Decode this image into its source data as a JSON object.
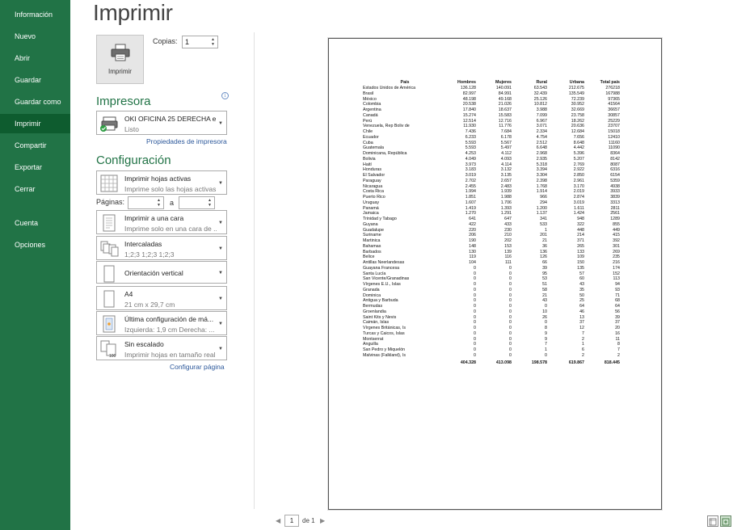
{
  "nav": {
    "items": [
      {
        "label": "Información"
      },
      {
        "label": "Nuevo"
      },
      {
        "label": "Abrir"
      },
      {
        "label": "Guardar"
      },
      {
        "label": "Guardar como"
      },
      {
        "label": "Imprimir",
        "active": true
      },
      {
        "label": "Compartir"
      },
      {
        "label": "Exportar"
      },
      {
        "label": "Cerrar"
      },
      {
        "label": "Cuenta"
      },
      {
        "label": "Opciones"
      }
    ]
  },
  "title": "Imprimir",
  "print_button": {
    "label": "Imprimir"
  },
  "copies": {
    "label": "Copias:",
    "value": "1"
  },
  "printer": {
    "heading": "Impresora",
    "name": "OKI OFICINA 25 DERECHA e...",
    "status": "Listo",
    "properties_link": "Propiedades de impresora"
  },
  "settings": {
    "heading": "Configuración",
    "what": {
      "title": "Imprimir hojas activas",
      "subtitle": "Imprime solo las hojas activas"
    },
    "pages_label": "Páginas:",
    "pages_to": "a",
    "pages_from_value": "",
    "pages_to_value": "",
    "sides": {
      "title": "Imprimir a una cara",
      "subtitle": "Imprime solo en una cara de ..."
    },
    "collate": {
      "title": "Intercaladas",
      "subtitle": "1;2;3    1;2;3    1;2;3"
    },
    "orientation": {
      "title": "Orientación vertical"
    },
    "paper": {
      "title": "A4",
      "subtitle": "21 cm x 29,7 cm"
    },
    "margins": {
      "title": "Última configuración de má...",
      "subtitle": "Izquierda: 1,9 cm    Derecha: ..."
    },
    "scaling": {
      "title": "Sin escalado",
      "subtitle": "Imprimir hojas en tamaño real",
      "badge": "100"
    },
    "page_setup_link": "Configurar página"
  },
  "preview": {
    "headers": [
      "País",
      "Hombres",
      "Mujeres",
      "Rural",
      "Urbana",
      "Total país"
    ],
    "rows": [
      [
        "Estados Unidos de América",
        "136.128",
        "140.091",
        "63.543",
        "212.675",
        "276218"
      ],
      [
        "Brasil",
        "82.997",
        "84.991",
        "32.439",
        "135.549",
        "167988"
      ],
      [
        "México",
        "48.198",
        "49.168",
        "25.126",
        "72.239",
        "97365"
      ],
      [
        "Colombia",
        "20.538",
        "21.026",
        "10.812",
        "30.952",
        "41564"
      ],
      [
        "Argentina",
        "17.840",
        "18.637",
        "3.988",
        "32.669",
        "36657"
      ],
      [
        "Canadá",
        "15.274",
        "15.583",
        "7.099",
        "23.758",
        "30857"
      ],
      [
        "Perú",
        "12.514",
        "12.716",
        "6.967",
        "18.262",
        "25229"
      ],
      [
        "Venezuela, Rep Boliv de",
        "11.930",
        "11.776",
        "3.071",
        "20.636",
        "23707"
      ],
      [
        "Chile",
        "7.436",
        "7.684",
        "2.334",
        "12.684",
        "15018"
      ],
      [
        "Ecuador",
        "6.233",
        "6.178",
        "4.754",
        "7.656",
        "12410"
      ],
      [
        "Cuba",
        "5.593",
        "5.567",
        "2.512",
        "8.648",
        "11160"
      ],
      [
        "Guatemala",
        "5.593",
        "5.497",
        "6.648",
        "4.442",
        "11090"
      ],
      [
        "Dominicana, República",
        "4.253",
        "4.112",
        "2.968",
        "5.396",
        "8364"
      ],
      [
        "Bolivia",
        "4.049",
        "4.093",
        "2.935",
        "5.207",
        "8142"
      ],
      [
        "Haití",
        "3.973",
        "4.114",
        "5.318",
        "2.769",
        "8087"
      ],
      [
        "Honduras",
        "3.183",
        "3.132",
        "3.394",
        "2.922",
        "6316"
      ],
      [
        "El Salvador",
        "3.019",
        "3.135",
        "3.304",
        "2.850",
        "6154"
      ],
      [
        "Paraguay",
        "2.702",
        "2.657",
        "2.398",
        "2.961",
        "5359"
      ],
      [
        "Nicaragua",
        "2.455",
        "2.483",
        "1.768",
        "3.170",
        "4938"
      ],
      [
        "Costa Rica",
        "1.994",
        "1.939",
        "1.914",
        "2.019",
        "3933"
      ],
      [
        "Puerto Rico",
        "1.851",
        "1.988",
        "966",
        "2.874",
        "3839"
      ],
      [
        "Uruguay",
        "1.607",
        "1.706",
        "294",
        "3.019",
        "3313"
      ],
      [
        "Panamá",
        "1.419",
        "1.393",
        "1.200",
        "1.611",
        "2811"
      ],
      [
        "Jamaica",
        "1.270",
        "1.291",
        "1.137",
        "1.424",
        "2561"
      ],
      [
        "Trinidad y Tabago",
        "641",
        "647",
        "341",
        "948",
        "1289"
      ],
      [
        "Guyana",
        "422",
        "433",
        "533",
        "322",
        "855"
      ],
      [
        "Guadalupe",
        "220",
        "230",
        "1",
        "448",
        "449"
      ],
      [
        "Suriname",
        "206",
        "210",
        "201",
        "214",
        "415"
      ],
      [
        "Martinica",
        "190",
        "202",
        "21",
        "371",
        "392"
      ],
      [
        "Bahamas",
        "148",
        "153",
        "36",
        "265",
        "301"
      ],
      [
        "Barbados",
        "130",
        "139",
        "136",
        "133",
        "269"
      ],
      [
        "Belice",
        "119",
        "116",
        "126",
        "109",
        "235"
      ],
      [
        "Antillas Neerlandesas",
        "104",
        "111",
        "66",
        "150",
        "216"
      ],
      [
        "Guayana Francesa",
        "0",
        "0",
        "39",
        "135",
        "174"
      ],
      [
        "Santa Lucía",
        "0",
        "0",
        "95",
        "57",
        "152"
      ],
      [
        "San Vicente/Granadinas",
        "0",
        "0",
        "53",
        "60",
        "113"
      ],
      [
        "Vírgenes E.U., Islas",
        "0",
        "0",
        "51",
        "43",
        "94"
      ],
      [
        "Granada",
        "0",
        "0",
        "58",
        "35",
        "93"
      ],
      [
        "Dominica",
        "0",
        "0",
        "21",
        "50",
        "71"
      ],
      [
        "Antigua y Barbuda",
        "0",
        "0",
        "43",
        "25",
        "68"
      ],
      [
        "Bermudas",
        "0",
        "0",
        "0",
        "64",
        "64"
      ],
      [
        "Groenlandia",
        "0",
        "0",
        "10",
        "46",
        "56"
      ],
      [
        "Saint Kits y Nevis",
        "0",
        "0",
        "26",
        "13",
        "39"
      ],
      [
        "Caimán, Islas",
        "0",
        "0",
        "0",
        "37",
        "37"
      ],
      [
        "Vírgenes Británicas, Is",
        "0",
        "0",
        "8",
        "12",
        "20"
      ],
      [
        "Turcas y Caicos, Islas",
        "0",
        "0",
        "9",
        "7",
        "16"
      ],
      [
        "Montserrat",
        "0",
        "0",
        "9",
        "2",
        "11"
      ],
      [
        "Anguilla",
        "0",
        "0",
        "7",
        "1",
        "8"
      ],
      [
        "San Pedro y Miquelón",
        "0",
        "0",
        "1",
        "6",
        "7"
      ],
      [
        "Malvinas (Falkland), Is",
        "0",
        "0",
        "0",
        "2",
        "2"
      ]
    ],
    "totals": [
      "",
      "404.328",
      "413.098",
      "198.578",
      "619.867",
      "818.445"
    ]
  },
  "pager": {
    "current": "1",
    "of_label": "de 1"
  }
}
